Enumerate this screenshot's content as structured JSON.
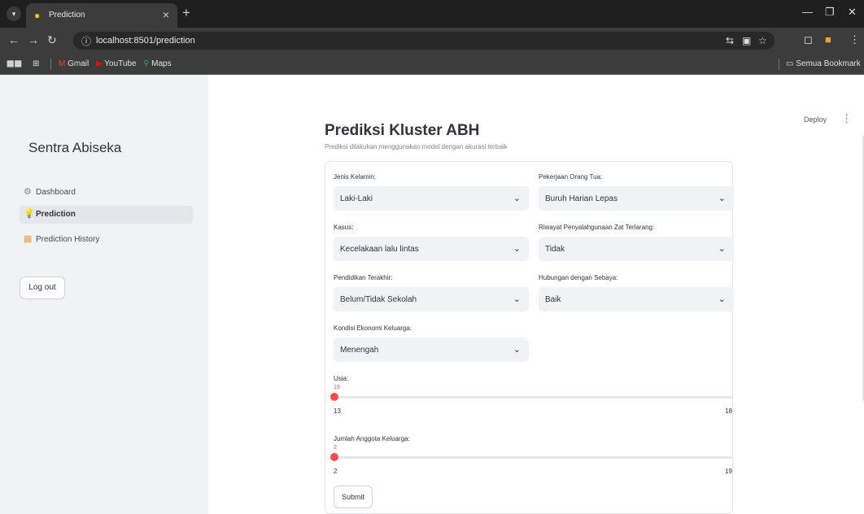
{
  "browser": {
    "tab_title": "Prediction",
    "url": "localhost:8501/prediction",
    "bookmarks": [
      "Gmail",
      "YouTube",
      "Maps"
    ],
    "all_bookmarks": "Semua Bookmark"
  },
  "sidebar": {
    "title": "Sentra Abiseka",
    "items": [
      {
        "label": "Dashboard",
        "icon": "gear-icon",
        "active": false
      },
      {
        "label": "Prediction",
        "icon": "lightbulb-icon",
        "active": true
      },
      {
        "label": "Prediction History",
        "icon": "calendar-icon",
        "active": false
      }
    ],
    "logout_label": "Log out"
  },
  "header": {
    "deploy_label": "Deploy"
  },
  "page": {
    "title": "Prediksi Kluster ABH",
    "subtitle": "Prediksi dilakukan menggunakan model dengan akurasi terbaik"
  },
  "form": {
    "fields": [
      {
        "label": "Jenis Kelamin:",
        "value": "Laki-Laki"
      },
      {
        "label": "Pekerjaan Orang Tua:",
        "value": "Buruh Harian Lepas"
      },
      {
        "label": "Kasus:",
        "value": "Kecelakaan lalu lintas"
      },
      {
        "label": "Riwayat Penyalahgunaan Zat Terlarang:",
        "value": "Tidak"
      },
      {
        "label": "Pendidikan Terakhir:",
        "value": "Belum/Tidak Sekolah"
      },
      {
        "label": "Hubungan dengan Sebaya:",
        "value": "Baik"
      },
      {
        "label": "Kondisi Ekonomi Keluarga:",
        "value": "Menengah"
      }
    ],
    "sliders": [
      {
        "label": "Usia:",
        "current": "13",
        "min": "13",
        "max": "18"
      },
      {
        "label": "Jumlah Anggota Keluarga:",
        "current": "2",
        "min": "2",
        "max": "19"
      }
    ],
    "submit_label": "Submit"
  },
  "colors": {
    "accent": "#ff4b4b",
    "sidebar_bg": "#f0f2f6",
    "select_bg": "#f0f2f6",
    "chrome_bg": "#3c3c3c"
  }
}
